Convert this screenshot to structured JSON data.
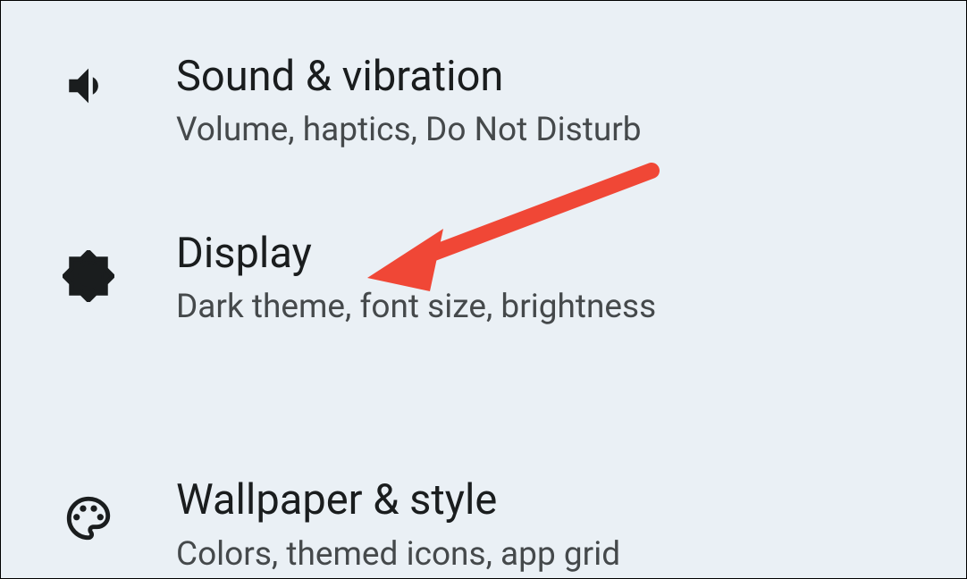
{
  "settings": {
    "items": [
      {
        "title": "Sound & vibration",
        "subtitle": "Volume, haptics, Do Not Disturb",
        "icon": "volume-up-icon"
      },
      {
        "title": "Display",
        "subtitle": "Dark theme, font size, brightness",
        "icon": "brightness-icon"
      },
      {
        "title": "Wallpaper & style",
        "subtitle": "Colors, themed icons, app grid",
        "icon": "palette-icon"
      }
    ]
  },
  "annotation": {
    "type": "arrow",
    "color": "#f04736",
    "target": "display-item"
  }
}
